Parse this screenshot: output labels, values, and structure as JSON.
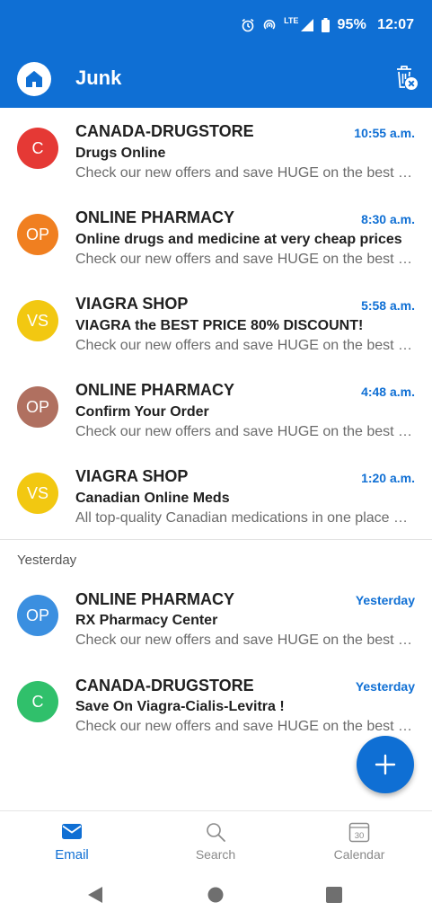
{
  "status_bar": {
    "lte": "LTE",
    "battery": "95%",
    "clock": "12:07"
  },
  "header": {
    "title": "Junk"
  },
  "colors": {
    "accent": "#0f6fd4",
    "time": "#0f6fd4"
  },
  "today": [
    {
      "initials": "C",
      "avatar_color": "#e53935",
      "sender": "CANADA-DRUGSTORE",
      "time": "10:55 a.m.",
      "subject": "Drugs Online",
      "preview": "Check our new offers and save HUGE on the best prices"
    },
    {
      "initials": "OP",
      "avatar_color": "#f07f20",
      "sender": "ONLINE PHARMACY",
      "time": "8:30 a.m.",
      "subject": "Online drugs and medicine at very cheap prices",
      "preview": "Check our new offers and save HUGE on the best prices"
    },
    {
      "initials": "VS",
      "avatar_color": "#f2c811",
      "sender": "VIAGRA SHOP",
      "time": "5:58 a.m.",
      "subject": "VIAGRA the BEST PRICE 80% DISCOUNT!",
      "preview": "Check our new offers and save HUGE on the best prices"
    },
    {
      "initials": "OP",
      "avatar_color": "#b07060",
      "sender": "ONLINE PHARMACY",
      "time": "4:48 a.m.",
      "subject": "Confirm Your Order",
      "preview": "Check our new offers and save HUGE on the best prices"
    },
    {
      "initials": "VS",
      "avatar_color": "#f2c811",
      "sender": "VIAGRA SHOP",
      "time": "1:20 a.m.",
      "subject": "Canadian Online Meds",
      "preview": "All top-quality Canadian medications in one place at the best prices"
    }
  ],
  "section": {
    "yesterday_label": "Yesterday"
  },
  "yesterday": [
    {
      "initials": "OP",
      "avatar_color": "#3b8fe0",
      "sender": "ONLINE PHARMACY",
      "time": "Yesterday",
      "subject": "RX Pharmacy Center",
      "preview": "Check our new offers and save HUGE on the best prices"
    },
    {
      "initials": "C",
      "avatar_color": "#30c06b",
      "sender": "CANADA-DRUGSTORE",
      "time": "Yesterday",
      "subject": "Save On Viagra-Cialis-Levitra !",
      "preview": "Check our new offers and save HUGE on the best prices"
    }
  ],
  "bottom_nav": [
    {
      "label": "Email",
      "icon": "mail-icon",
      "active": true
    },
    {
      "label": "Search",
      "icon": "search-icon",
      "active": false
    },
    {
      "label": "Calendar",
      "icon": "calendar-icon",
      "active": false,
      "badge": "30"
    }
  ]
}
